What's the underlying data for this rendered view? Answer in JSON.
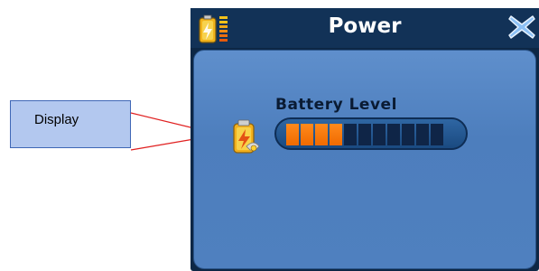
{
  "window": {
    "title": "Power"
  },
  "panel": {
    "battery_label": "Battery Level",
    "battery_level": {
      "filled_segments": 4,
      "total_segments": 11
    }
  },
  "annotation": {
    "text": "Display"
  },
  "icons": {
    "title": "battery-level-icon",
    "close": "close-x-icon",
    "panel": "battery-charging-icon"
  },
  "colors": {
    "title_bar": "#123257",
    "panel": "#5f8fcc",
    "segment_on": "#f07a10",
    "segment_off": "#0f2547",
    "close": "#7fb2ee",
    "callout_fill": "#b3c8ef",
    "callout_line": "#e02020"
  }
}
